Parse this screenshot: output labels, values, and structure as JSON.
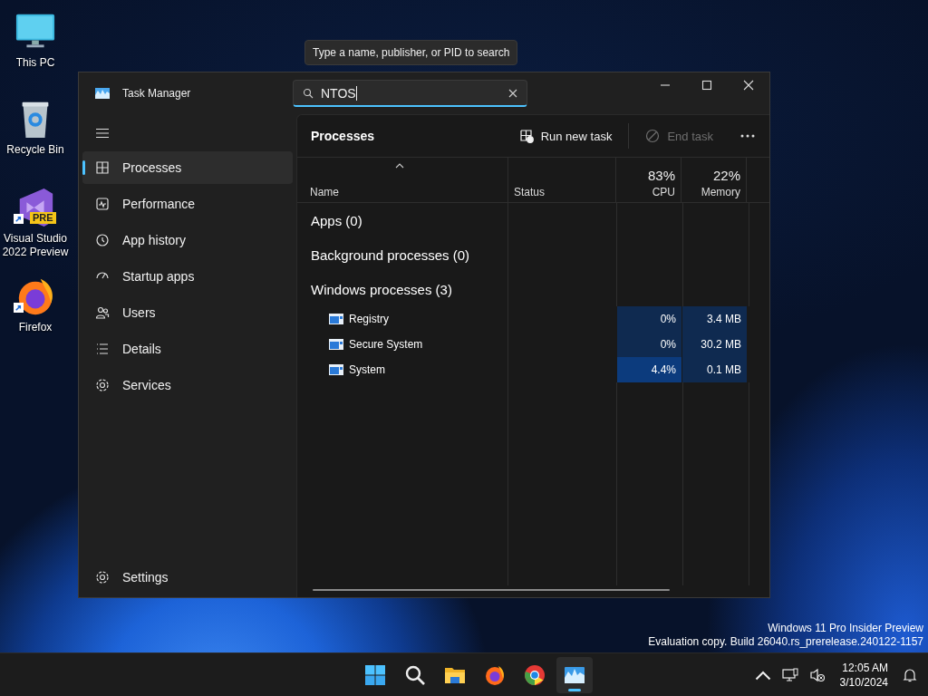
{
  "desktop_icons": [
    {
      "label": "This PC",
      "kind": "monitor",
      "shortcut": false
    },
    {
      "label": "Recycle Bin",
      "kind": "bin",
      "shortcut": false
    },
    {
      "label": "Visual Studio 2022 Preview",
      "kind": "vs",
      "badge": "PRE",
      "shortcut": true
    },
    {
      "label": "Firefox",
      "kind": "firefox",
      "shortcut": true
    }
  ],
  "tooltip": "Type a name, publisher, or PID to search",
  "window": {
    "title": "Task Manager"
  },
  "search": {
    "value": "NTOS"
  },
  "sidebar": {
    "items": [
      {
        "label": "Processes",
        "kind": "processes",
        "selected": true
      },
      {
        "label": "Performance",
        "kind": "performance",
        "selected": false
      },
      {
        "label": "App history",
        "kind": "history",
        "selected": false
      },
      {
        "label": "Startup apps",
        "kind": "startup",
        "selected": false
      },
      {
        "label": "Users",
        "kind": "users",
        "selected": false
      },
      {
        "label": "Details",
        "kind": "details",
        "selected": false
      },
      {
        "label": "Services",
        "kind": "services",
        "selected": false
      }
    ],
    "footer": {
      "label": "Settings"
    }
  },
  "toolbar": {
    "title": "Processes",
    "actions": [
      {
        "label": "Run new task",
        "kind": "run",
        "disabled": false
      },
      {
        "label": "End task",
        "kind": "end",
        "disabled": true
      }
    ]
  },
  "table": {
    "columns": [
      {
        "label": "Name",
        "sorted": true
      },
      {
        "label": "Status",
        "sorted": false
      },
      {
        "label": "CPU",
        "total": "83%",
        "sorted": false
      },
      {
        "label": "Memory",
        "total": "22%",
        "sorted": false
      }
    ],
    "groups": [
      {
        "label": "Apps (0)"
      },
      {
        "label": "Background processes (0)"
      },
      {
        "label": "Windows processes (3)",
        "rows": [
          {
            "name": "Registry",
            "cpu": {
              "text": "0%",
              "color": "#0f2a50"
            },
            "memory": {
              "text": "3.4 MB",
              "color": "#0f2a50"
            }
          },
          {
            "name": "Secure System",
            "cpu": {
              "text": "0%",
              "color": "#0f2a50"
            },
            "memory": {
              "text": "30.2 MB",
              "color": "#0f2a50"
            }
          },
          {
            "name": "System",
            "cpu": {
              "text": "4.4%",
              "color": "#0c3b7d"
            },
            "memory": {
              "text": "0.1 MB",
              "color": "#0f2a50"
            }
          }
        ]
      }
    ]
  },
  "desktop_notice": [
    "Windows 11 Pro Insider Preview",
    "Evaluation copy. Build 26040.rs_prerelease.240122-1157"
  ],
  "taskbar": {
    "apps": [
      {
        "kind": "start",
        "active": false
      },
      {
        "kind": "search",
        "active": false
      },
      {
        "kind": "explorer",
        "active": false
      },
      {
        "kind": "firefox",
        "active": false
      },
      {
        "kind": "chrome",
        "active": false
      },
      {
        "kind": "taskmanager",
        "active": true
      }
    ],
    "time": "12:05 AM",
    "date": "3/10/2024"
  }
}
